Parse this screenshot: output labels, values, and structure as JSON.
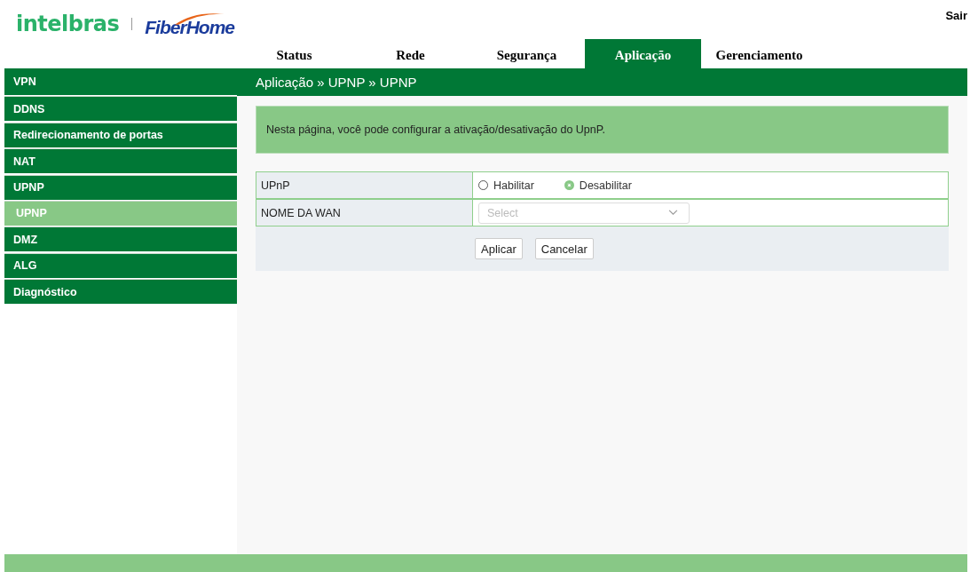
{
  "logo": {
    "brand": "intelbras",
    "partner": "FiberHome"
  },
  "logout": "Sair",
  "tabs": [
    {
      "label": "Status",
      "selected": false
    },
    {
      "label": "Rede",
      "selected": false
    },
    {
      "label": "Segurança",
      "selected": false
    },
    {
      "label": "Aplicação",
      "selected": true
    },
    {
      "label": "Gerenciamento",
      "selected": false
    }
  ],
  "sidebar": {
    "items": [
      {
        "label": "VPN",
        "selected": false
      },
      {
        "label": "DDNS",
        "selected": false
      },
      {
        "label": "Redirecionamento de portas",
        "selected": false
      },
      {
        "label": "NAT",
        "selected": false
      },
      {
        "label": "UPNP",
        "selected": false,
        "children": [
          {
            "label": "UPNP",
            "selected": true
          }
        ]
      },
      {
        "label": "DMZ",
        "selected": false
      },
      {
        "label": "ALG",
        "selected": false
      },
      {
        "label": "Diagnóstico",
        "selected": false
      }
    ]
  },
  "breadcrumb": "Aplicação » UPNP » UPNP",
  "info": "Nesta página, você pode configurar a ativação/desativação do UpnP.",
  "form": {
    "rows": [
      {
        "label": "UPnP",
        "kind": "radio",
        "options": [
          {
            "label": "Habilitar",
            "selected": false
          },
          {
            "label": "Desabilitar",
            "selected": true
          }
        ]
      },
      {
        "label": "NOME DA WAN",
        "kind": "select",
        "placeholder": "Select"
      }
    ],
    "buttons": [
      "Aplicar",
      "Cancelar"
    ]
  }
}
